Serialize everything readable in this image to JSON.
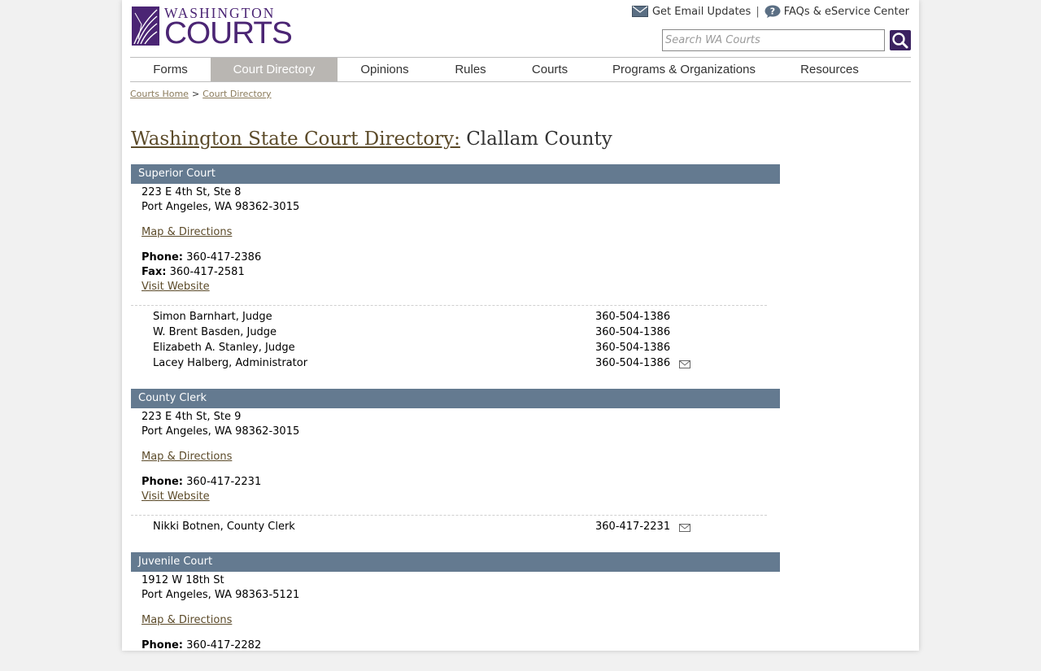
{
  "header": {
    "logo_top": "WASHINGTON",
    "logo_bottom": "COURTS",
    "email_updates": "Get Email Updates",
    "separator": "|",
    "faqs": "FAQs & eService Center",
    "search_placeholder": "Search WA Courts"
  },
  "nav": [
    "Forms",
    "Court Directory",
    "Opinions",
    "Rules",
    "Courts",
    "Programs & Organizations",
    "Resources"
  ],
  "nav_active": "Court Directory",
  "breadcrumb": {
    "home": "Courts Home",
    "sep": ">",
    "current": "Court Directory"
  },
  "title": {
    "link": "Washington State Court Directory:",
    "county": "Clallam County"
  },
  "labels": {
    "phone": "Phone:",
    "fax": "Fax:",
    "map": "Map & Directions",
    "website": "Visit Website"
  },
  "sections": [
    {
      "name": "Superior Court",
      "address1": "223 E 4th St, Ste 8",
      "address2": "Port Angeles, WA 98362-3015",
      "phone": "360-417-2386",
      "fax": "360-417-2581",
      "staff": [
        {
          "name": "Simon Barnhart, Judge",
          "phone": "360-504-1386"
        },
        {
          "name": "W. Brent Basden, Judge",
          "phone": "360-504-1386"
        },
        {
          "name": "Elizabeth A. Stanley, Judge",
          "phone": "360-504-1386"
        },
        {
          "name": "Lacey Halberg, Administrator",
          "phone": "360-504-1386"
        }
      ]
    },
    {
      "name": "County Clerk",
      "address1": "223 E 4th St, Ste 9",
      "address2": "Port Angeles, WA 98362-3015",
      "phone": "360-417-2231",
      "staff": [
        {
          "name": "Nikki Botnen, County Clerk",
          "phone": "360-417-2231"
        }
      ]
    },
    {
      "name": "Juvenile Court",
      "address1": "1912 W 18th St",
      "address2": "Port Angeles, WA 98363-5121",
      "phone": "360-417-2282"
    }
  ],
  "colors": {
    "brand": "#4b2574",
    "section_header": "#647a90",
    "nav_active": "#b9b6b2"
  }
}
